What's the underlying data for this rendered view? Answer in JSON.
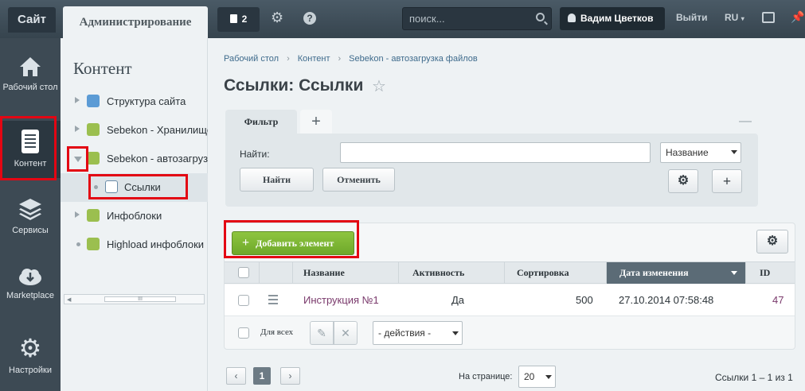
{
  "topbar": {
    "site_tab": "Сайт",
    "admin_tab": "Администрирование",
    "notifications_count": "2",
    "search_placeholder": "поиск...",
    "user_name": "Вадим Цветков",
    "logout": "Выйти",
    "language": "RU"
  },
  "leftnav": {
    "items": [
      {
        "label": "Рабочий стол",
        "icon": "home-icon"
      },
      {
        "label": "Контент",
        "icon": "document-icon"
      },
      {
        "label": "Сервисы",
        "icon": "layers-icon"
      },
      {
        "label": "Marketplace",
        "icon": "cloud-download-icon"
      },
      {
        "label": "Настройки",
        "icon": "gear-icon"
      }
    ],
    "active": "Контент"
  },
  "tree": {
    "title": "Контент",
    "items": [
      {
        "label": "Структура сайта",
        "icon": "sitemap-icon"
      },
      {
        "label": "Sebekon - Хранилище",
        "icon": "folder-icon"
      },
      {
        "label": "Sebekon - автозагрузка",
        "icon": "folder-icon"
      },
      {
        "label": "Ссылки",
        "icon": "list-icon"
      },
      {
        "label": "Инфоблоки",
        "icon": "infoblock-icon"
      },
      {
        "label": "Highload инфоблоки",
        "icon": "highload-icon"
      }
    ],
    "scroll_glyph": "III"
  },
  "breadcrumb": {
    "items": [
      "Рабочий стол",
      "Контент",
      "Sebekon - автозагрузка файлов"
    ]
  },
  "page": {
    "title": "Ссылки: Ссылки"
  },
  "filter": {
    "tab_label": "Фильтр",
    "add_tab": "+",
    "collapse": "—",
    "find_label": "Найти:",
    "find_value": "",
    "field_select": "Название",
    "find_button": "Найти",
    "cancel_button": "Отменить",
    "add_button": "+"
  },
  "grid": {
    "add_button": "Добавить элемент",
    "columns": [
      "Название",
      "Активность",
      "Сортировка",
      "Дата изменения",
      "ID"
    ],
    "sorted_column": "Дата изменения",
    "rows": [
      {
        "name": "Инструкция №1",
        "active": "Да",
        "sort": "500",
        "date": "27.10.2014 07:58:48",
        "id": "47"
      }
    ],
    "for_all": "Для всех",
    "actions_select": "- действия -"
  },
  "pager": {
    "prev": "‹",
    "page": "1",
    "next": "›",
    "per_page_label": "На странице:",
    "per_page_value": "20",
    "summary": "Ссылки 1 – 1 из 1"
  },
  "colors": {
    "highlight": "#e30613",
    "add_button": "#7ab834",
    "sidebar": "#3d4a54"
  }
}
